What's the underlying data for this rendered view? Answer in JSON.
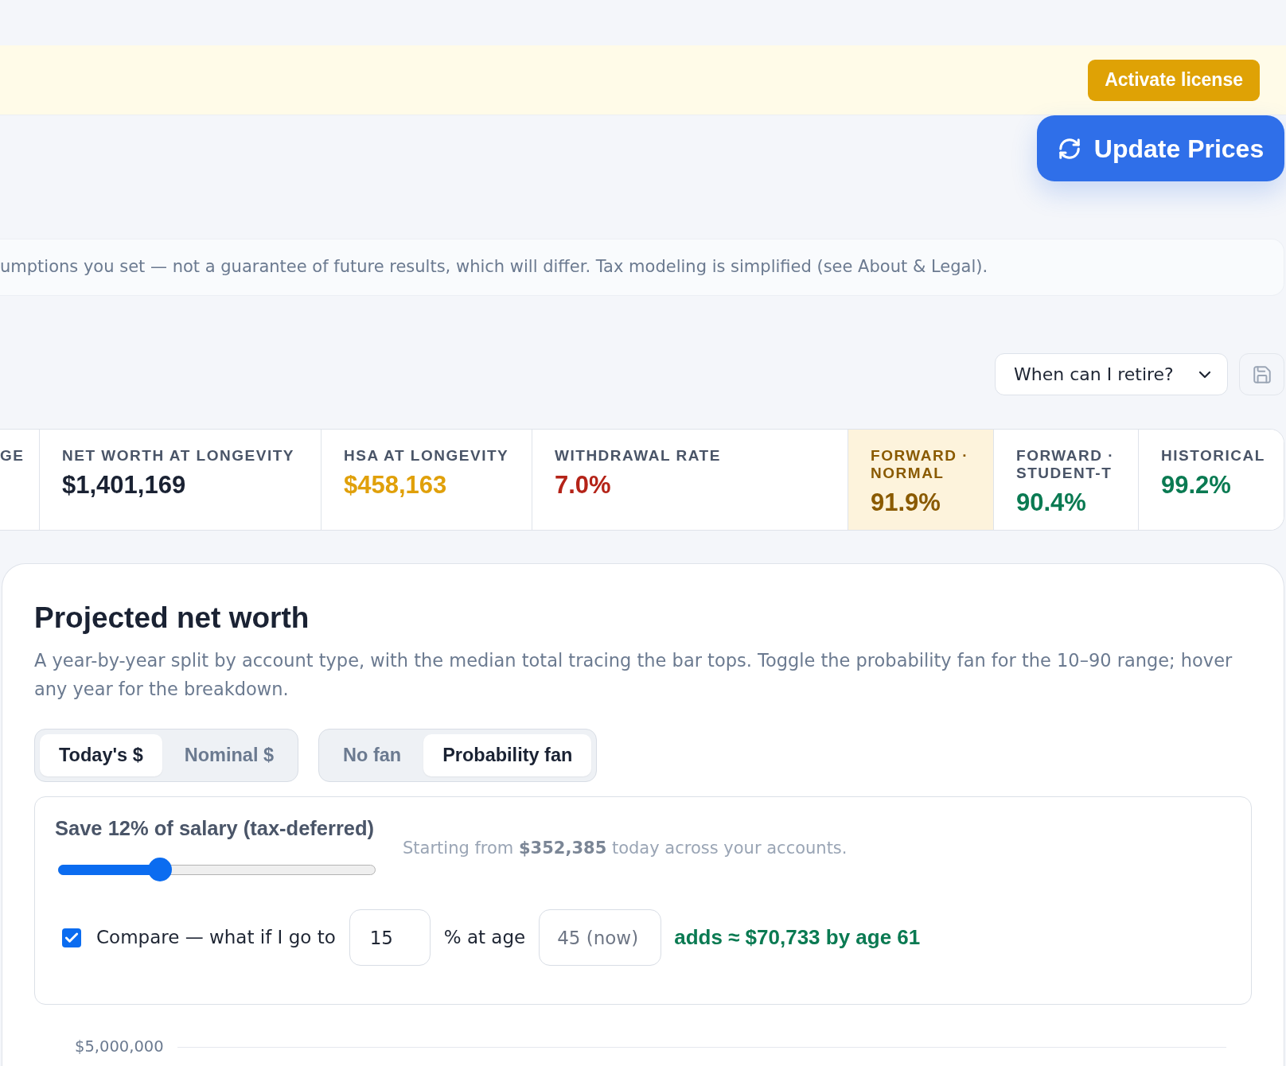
{
  "banner": {
    "button": "Activate license"
  },
  "update_button": {
    "label": "Update Prices"
  },
  "disclaimer": "umptions you set — not a guarantee of future results, which will differ. Tax modeling is simplified (see About & Legal).",
  "scenario_select": {
    "value": "When can I retire?"
  },
  "stats": [
    {
      "label": "GE",
      "highlighted": false
    },
    {
      "label": "NET WORTH AT LONGEVITY",
      "value": "$1,401,169",
      "color": "#1a2233",
      "highlighted": false
    },
    {
      "label": "HSA AT LONGEVITY",
      "value": "$458,163",
      "color": "#e0a00a",
      "highlighted": false
    },
    {
      "label": "WITHDRAWAL RATE",
      "value": "7.0%",
      "color": "#b42318",
      "highlighted": false
    },
    {
      "label": "FORWARD · NORMAL",
      "value": "91.9%",
      "color": "#8a5a00",
      "highlighted": true
    },
    {
      "label": "FORWARD · STUDENT-T",
      "value": "90.4%",
      "color": "#0a7a52",
      "highlighted": false
    },
    {
      "label": "HISTORICAL",
      "value": "99.2%",
      "color": "#0a7a52",
      "highlighted": false
    }
  ],
  "projection": {
    "title": "Projected net worth",
    "description": "A year-by-year split by account type, with the median total tracing the bar tops. Toggle the probability fan for the 10–90 range; hover any year for the breakdown.",
    "currency_toggle": [
      {
        "label": "Today's $",
        "selected": true
      },
      {
        "label": "Nominal $",
        "selected": false
      }
    ],
    "fan_toggle": [
      {
        "label": "No fan",
        "selected": false
      },
      {
        "label": "Probability fan",
        "selected": true
      }
    ],
    "savings": {
      "label": "Save 12% of salary (tax-deferred)",
      "level": 0.32,
      "summary": "Starting from **$352,385** today across your accounts.",
      "compare": {
        "checked": true,
        "label": "Compare — what if I go to",
        "percent": "15",
        "age_label": "% at age",
        "age_placeholder": "45 (now)",
        "result": "adds ≈ $70,733 by age 61"
      }
    },
    "chart": {
      "y_axis_label": "$5,000,000"
    }
  }
}
